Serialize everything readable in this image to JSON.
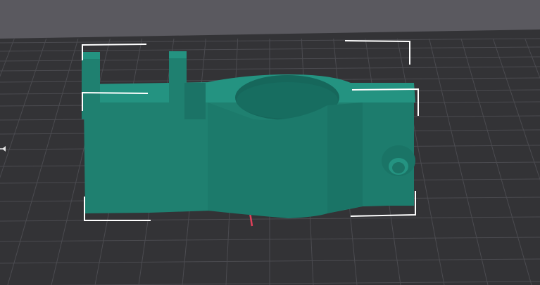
{
  "viewport": {
    "background_color": "#5a595f",
    "bed_color": "#333336",
    "grid_color": "#4b4b50",
    "model_color": "#1f8070",
    "model_shadow": "#16675b",
    "model_highlight": "#249381",
    "selection_color": "#ffffff",
    "axis_color": "#e0405a"
  },
  "model": {
    "name_icon": "selected-3d-part"
  },
  "indicators": {
    "left_arrow_icon": "pan-left-arrow-icon"
  }
}
